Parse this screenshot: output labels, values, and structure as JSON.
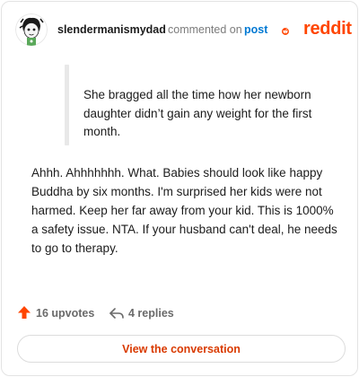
{
  "header": {
    "username": "slendermanismydad",
    "action_text": "commented on",
    "post_link": "post",
    "logo_word": "reddit"
  },
  "quote": {
    "text": "She bragged all the time how her newborn daughter didn’t gain any weight for the first month."
  },
  "comment": {
    "body": "Ahhh. Ahhhhhhh. What. Babies should look like happy Buddha by six months. I'm surprised her kids were not harmed. Keep her far away from your kid. This is 1000% a safety issue. NTA. If your husband can't deal, he needs to go to therapy."
  },
  "stats": {
    "upvotes_label": "16 upvotes",
    "replies_label": "4 replies"
  },
  "actions": {
    "view_conversation_label": "View the conversation"
  },
  "icons": {
    "upvote": "upvote-arrow-icon",
    "reply": "reply-arrow-icon",
    "logo": "reddit-snoo-icon",
    "avatar": "user-avatar"
  },
  "colors": {
    "brand": "#ff4500",
    "link": "#0079d3",
    "button_text": "#d93a00",
    "muted": "#6a6a6a"
  }
}
